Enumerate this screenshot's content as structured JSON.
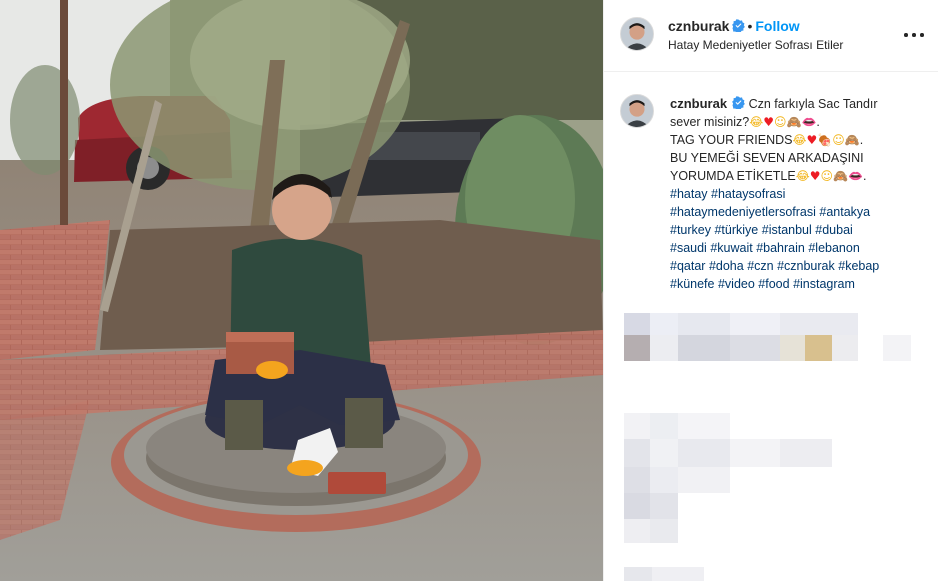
{
  "post": {
    "username": "cznburak",
    "follow_label": "Follow",
    "location": "Hatay Medeniyetler Sofrası Etiler",
    "caption": {
      "username": "cznburak",
      "line1_text": "Czn farkıyla Sac Tandır",
      "line2_text": "sever misiniz?",
      "line3_text": "TAG YOUR FRIENDS",
      "line4_text": "BU YEMEĞİ SEVEN ARKADAŞINI",
      "line5_text": "YORUMDA ETİKETLE",
      "hashtags": [
        "#hatay",
        "#hataysofrasi",
        "#hataymedeniyetlersofrasi",
        "#antakya",
        "#turkey",
        "#türkiye",
        "#istanbul",
        "#dubai",
        "#saudi",
        "#kuwait",
        "#bahrain",
        "#lebanon",
        "#qatar",
        "#doha",
        "#czn",
        "#cznburak",
        "#kebap",
        "#künefe",
        "#video",
        "#food",
        "#instagram"
      ]
    }
  },
  "icons": {
    "verified": "verified-badge-icon",
    "more": "more-options-icon",
    "emoji_laugh": "😂",
    "emoji_heart": "♥",
    "emoji_yum": "☺",
    "emoji_monkey": "🙈",
    "emoji_meat": "🍖",
    "emoji_lips": "👄"
  },
  "colors": {
    "link": "#0095f6",
    "hashtag": "#00376b",
    "text": "#262626",
    "divider": "#efefef"
  }
}
